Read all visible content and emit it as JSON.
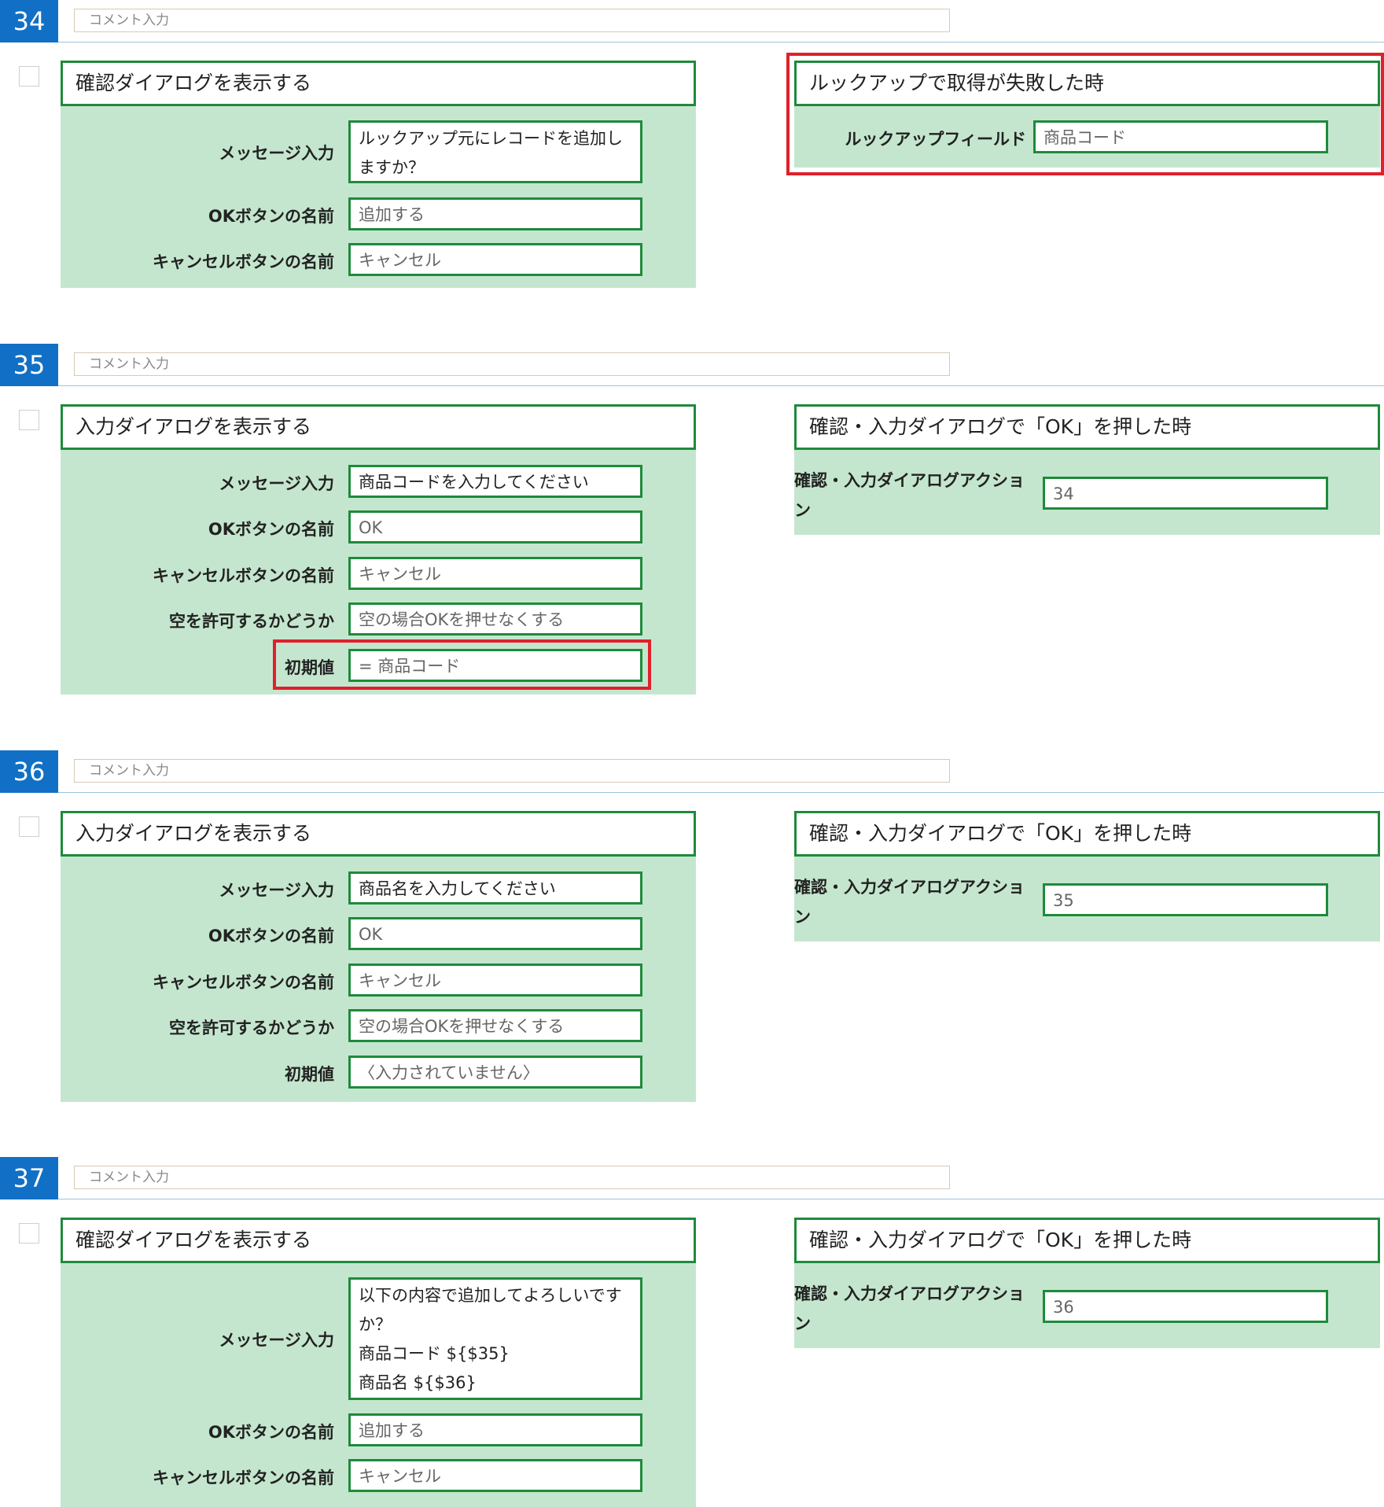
{
  "comment_placeholder": "コメント入力",
  "rows": [
    {
      "number": "34",
      "left_panel": {
        "title": "確認ダイアログを表示する",
        "fields": [
          {
            "label": "メッセージ入力",
            "value": "ルックアップ元にレコードを追加しますか？"
          },
          {
            "label": "OKボタンの名前",
            "value": "追加する"
          },
          {
            "label": "キャンセルボタンの名前",
            "value": "キャンセル"
          }
        ]
      },
      "right_panel": {
        "title": "ルックアップで取得が失敗した時",
        "fields": [
          {
            "label": "ルックアップフィールド",
            "value": "商品コード"
          }
        ]
      }
    },
    {
      "number": "35",
      "left_panel": {
        "title": "入力ダイアログを表示する",
        "fields": [
          {
            "label": "メッセージ入力",
            "value": "商品コードを入力してください"
          },
          {
            "label": "OKボタンの名前",
            "value": "OK"
          },
          {
            "label": "キャンセルボタンの名前",
            "value": "キャンセル"
          },
          {
            "label": "空を許可するかどうか",
            "value": "空の場合OKを押せなくする"
          },
          {
            "label": "初期値",
            "value": "= 商品コード"
          }
        ]
      },
      "right_panel": {
        "title": "確認・入力ダイアログで「OK」を押した時",
        "fields": [
          {
            "label": "確認・入力ダイアログアクション",
            "value": "34"
          }
        ]
      }
    },
    {
      "number": "36",
      "left_panel": {
        "title": "入力ダイアログを表示する",
        "fields": [
          {
            "label": "メッセージ入力",
            "value": "商品名を入力してください"
          },
          {
            "label": "OKボタンの名前",
            "value": "OK"
          },
          {
            "label": "キャンセルボタンの名前",
            "value": "キャンセル"
          },
          {
            "label": "空を許可するかどうか",
            "value": "空の場合OKを押せなくする"
          },
          {
            "label": "初期値",
            "value": "〈入力されていません〉"
          }
        ]
      },
      "right_panel": {
        "title": "確認・入力ダイアログで「OK」を押した時",
        "fields": [
          {
            "label": "確認・入力ダイアログアクション",
            "value": "35"
          }
        ]
      }
    },
    {
      "number": "37",
      "left_panel": {
        "title": "確認ダイアログを表示する",
        "fields": [
          {
            "label": "メッセージ入力",
            "lines": [
              "以下の内容で追加してよろしいです",
              "か？",
              "商品コード ${$35}",
              "商品名 ${$36}"
            ]
          },
          {
            "label": "OKボタンの名前",
            "value": "追加する"
          },
          {
            "label": "キャンセルボタンの名前",
            "value": "キャンセル"
          }
        ]
      },
      "right_panel": {
        "title": "確認・入力ダイアログで「OK」を押した時",
        "fields": [
          {
            "label": "確認・入力ダイアログアクション",
            "value": "36"
          }
        ]
      }
    }
  ],
  "colors": {
    "badge": "#1170c5",
    "panel_bg": "#c5e6ce",
    "panel_border": "#1e8a3c",
    "highlight": "#e0202a"
  }
}
